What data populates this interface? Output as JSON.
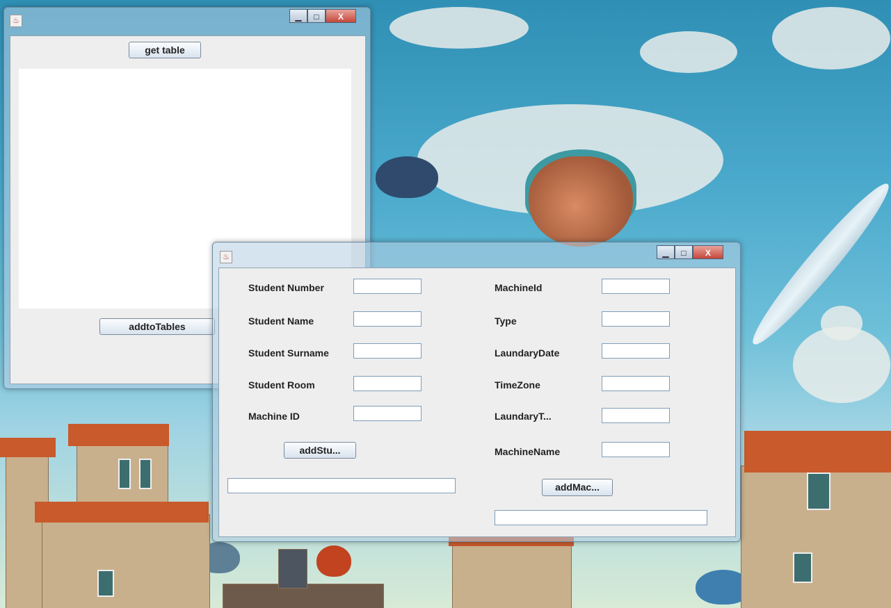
{
  "window_back": {
    "get_table_label": "get table",
    "add_to_tables_label": "addtoTables"
  },
  "window_front": {
    "left": [
      {
        "label": "Student Number",
        "value": ""
      },
      {
        "label": "Student Name",
        "value": ""
      },
      {
        "label": "Student Surname",
        "value": ""
      },
      {
        "label": "Student Room",
        "value": ""
      },
      {
        "label": "Machine ID",
        "value": ""
      }
    ],
    "right": [
      {
        "label": "MachineId",
        "value": ""
      },
      {
        "label": "Type",
        "value": ""
      },
      {
        "label": "LaundaryDate",
        "value": ""
      },
      {
        "label": "TimeZone",
        "value": ""
      },
      {
        "label": "LaundaryT...",
        "value": ""
      },
      {
        "label": "MachineName",
        "value": ""
      }
    ],
    "add_student_label": "addStu...",
    "add_machine_label": "addMac...",
    "student_output": "",
    "machine_output": ""
  },
  "controls": {
    "minimize_icon": "minimize-icon",
    "maximize_icon": "maximize-icon",
    "close_glyph": "X"
  },
  "colors": {
    "panel_bg": "#eeeeee",
    "close_red": "#c4473a"
  }
}
